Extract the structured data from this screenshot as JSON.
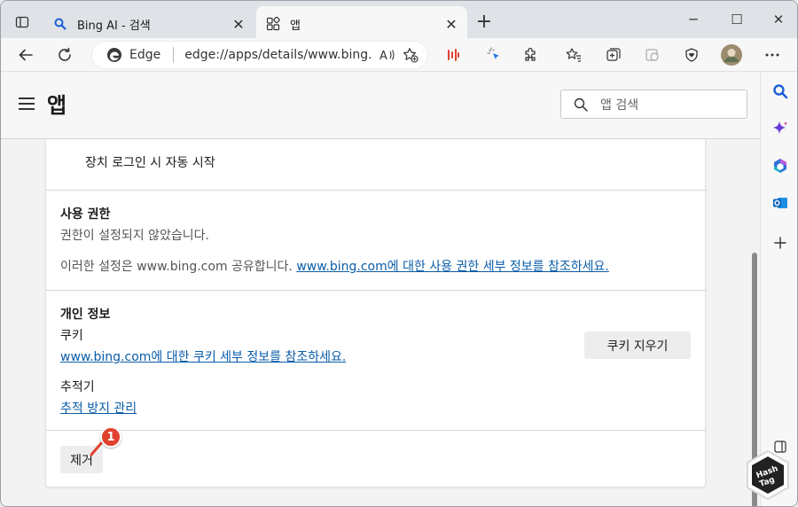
{
  "tabs": [
    {
      "title": "Bing AI - 검색",
      "close": "✕"
    },
    {
      "title": "앱",
      "close": "✕"
    }
  ],
  "new_tab": "+",
  "window_controls": {
    "minimize": "─",
    "maximize": "☐",
    "close": "✕"
  },
  "address_bar": {
    "site_label": "Edge",
    "url": "edge://apps/details/www.bing...."
  },
  "app_header": {
    "title": "앱",
    "search_placeholder": "앱 검색"
  },
  "startup": {
    "label": "장치 로그인 시 자동 시작"
  },
  "permissions": {
    "heading": "사용 권한",
    "status": "권한이 설정되지 않았습니다.",
    "note_prefix": "이러한 설정은 www.bing.com 공유합니다.",
    "note_link": "www.bing.com에 대한 사용 권한 세부 정보를 참조하세요."
  },
  "privacy": {
    "heading": "개인 정보",
    "cookies_label": "쿠키",
    "cookies_link": "www.bing.com에 대한 쿠키 세부 정보를 참조하세요.",
    "clear_cookies_button": "쿠키 지우기",
    "tracker_label": "추적기",
    "tracker_link": "추적 방지 관리"
  },
  "remove": {
    "button": "제거"
  },
  "annotation": {
    "step_number": "1"
  },
  "watermark": {
    "text_top": "Hash",
    "text_bottom": "Tag"
  },
  "colors": {
    "link": "#0a5da8",
    "badge": "#e0412f",
    "copilot": "#6b3fd6",
    "search_blue": "#1a5fd6"
  }
}
